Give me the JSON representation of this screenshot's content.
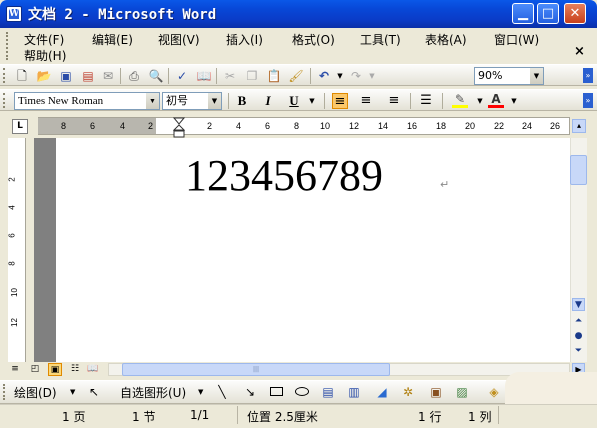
{
  "window": {
    "title": "文档 2 - Microsoft Word",
    "app_icon_letter": "W",
    "buttons": {
      "minimize": "▁",
      "maximize": "□",
      "close": "✕"
    }
  },
  "menu": {
    "items": [
      "文件(F)",
      "编辑(E)",
      "视图(V)",
      "插入(I)",
      "格式(O)",
      "工具(T)",
      "表格(A)",
      "窗口(W)",
      "帮助(H)"
    ],
    "doc_close": "×"
  },
  "toolbar_standard": {
    "icons": [
      "new-icon",
      "open-icon",
      "save-icon",
      "permission-icon",
      "email-icon",
      "print-icon",
      "print-preview-icon",
      "spelling-icon",
      "research-icon",
      "cut-icon",
      "copy-icon",
      "paste-icon",
      "format-painter-icon",
      "undo-icon",
      "redo-icon"
    ],
    "zoom": "90%"
  },
  "toolbar_formatting": {
    "font": "Times New Roman",
    "size": "初号",
    "bold": "B",
    "italic": "I",
    "underline": "U",
    "align_left_active": true,
    "highlight_color": "#ffff00",
    "font_color": "#ff0000"
  },
  "ruler": {
    "left_ticks": [
      "8",
      "6",
      "4",
      "2"
    ],
    "right_ticks": [
      "2",
      "4",
      "6",
      "8",
      "10",
      "12",
      "14",
      "16",
      "18",
      "20",
      "22",
      "24",
      "26"
    ],
    "tab_selector": "L"
  },
  "vertical_ruler": {
    "ticks": [
      "2",
      "4",
      "6",
      "8",
      "10",
      "12"
    ]
  },
  "document": {
    "text": "123456789",
    "paragraph_mark": "↵"
  },
  "drawing_toolbar": {
    "draw_label": "绘图(D)",
    "autoshapes_label": "自选图形(U)",
    "icons": [
      "select-arrow-icon",
      "line-icon",
      "arrow-icon",
      "rectangle-icon",
      "oval-icon",
      "textbox-icon",
      "vertical-textbox-icon",
      "wordart-icon",
      "diagram-icon",
      "clipart-icon",
      "picture-icon",
      "fill-color-icon"
    ]
  },
  "status": {
    "page": "1 页",
    "section": "1 节",
    "page_of": "1/1",
    "position": "位置 2.5厘米",
    "line": "1 行",
    "column": "1 列"
  }
}
